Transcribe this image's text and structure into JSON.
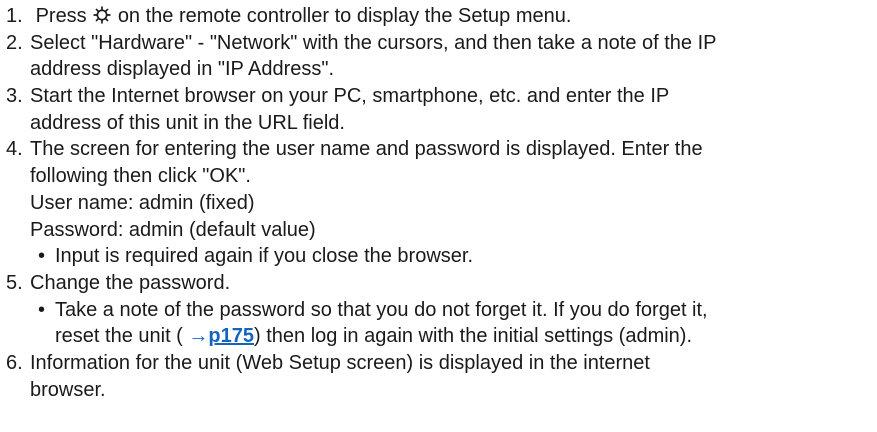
{
  "steps": [
    {
      "number": "1.",
      "lines": {
        "l1_before": "Press",
        "l1_icon": "gear-icon",
        "l1_after": "on the remote controller to display the Setup menu."
      }
    },
    {
      "number": "2.",
      "lines": {
        "l1": "Select \"Hardware\" - \"Network\" with the cursors, and then take a note of the IP",
        "l2": "address displayed in \"IP Address\"."
      }
    },
    {
      "number": "3.",
      "lines": {
        "l1": "Start the Internet browser on your PC, smartphone, etc. and enter the IP",
        "l2": "address of this unit in the URL field."
      }
    },
    {
      "number": "4.",
      "lines": {
        "l1": "The screen for entering the user name and password is displayed. Enter the",
        "l2": "following then click \"OK\".",
        "l3": "User name: admin (fixed)",
        "l4": "Password: admin (default value)"
      },
      "bullet": {
        "l1": "Input is required again if you close the browser."
      }
    },
    {
      "number": "5.",
      "lines": {
        "l1": "Change the password."
      },
      "bullet": {
        "l1": "Take a note of the password so that you do not forget it. If you do forget it,",
        "l2_before": "reset the unit (",
        "l2_arrow": "→",
        "l2_link": "p175",
        "l2_after": ") then log in again with the initial settings (admin)."
      }
    },
    {
      "number": "6.",
      "lines": {
        "l1": "Information for the unit (Web Setup screen) is displayed in the internet",
        "l2": "browser."
      }
    }
  ],
  "bullet_char": "•",
  "colors": {
    "text": "#1a1a1a",
    "link": "#1565c0"
  }
}
